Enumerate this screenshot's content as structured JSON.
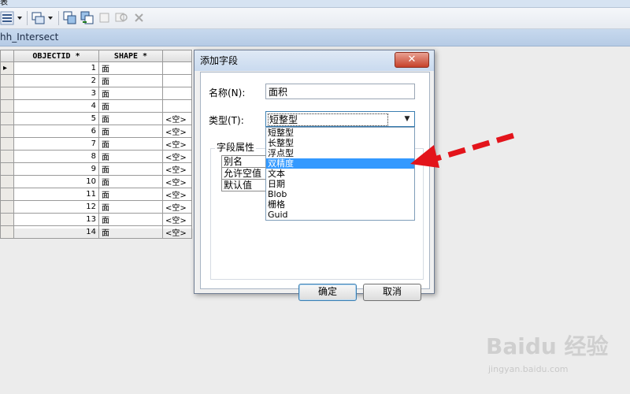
{
  "window": {
    "title_fragment": "表"
  },
  "table_caption": "hh_Intersect",
  "grid": {
    "columns": [
      "OBJECTID *",
      "SHAPE *"
    ],
    "rows": [
      {
        "id": "1",
        "shape": "面",
        "extra": ""
      },
      {
        "id": "2",
        "shape": "面",
        "extra": ""
      },
      {
        "id": "3",
        "shape": "面",
        "extra": ""
      },
      {
        "id": "4",
        "shape": "面",
        "extra": ""
      },
      {
        "id": "5",
        "shape": "面",
        "extra": "<空>"
      },
      {
        "id": "6",
        "shape": "面",
        "extra": "<空>"
      },
      {
        "id": "7",
        "shape": "面",
        "extra": "<空>"
      },
      {
        "id": "8",
        "shape": "面",
        "extra": "<空>"
      },
      {
        "id": "9",
        "shape": "面",
        "extra": "<空>"
      },
      {
        "id": "10",
        "shape": "面",
        "extra": "<空>"
      },
      {
        "id": "11",
        "shape": "面",
        "extra": "<空>"
      },
      {
        "id": "12",
        "shape": "面",
        "extra": "<空>"
      },
      {
        "id": "13",
        "shape": "面",
        "extra": "<空>"
      },
      {
        "id": "14",
        "shape": "面",
        "extra": "<空>"
      }
    ]
  },
  "dialog": {
    "title": "添加字段",
    "close_label": "✕",
    "name_label": "名称(N):",
    "name_value": "面积",
    "type_label": "类型(T):",
    "type_value": "短整型",
    "field_props_label": "字段属性",
    "prop_rows": [
      "别名",
      "允许空值",
      "默认值"
    ],
    "type_options": [
      "短整型",
      "长整型",
      "浮点型",
      "双精度",
      "文本",
      "日期",
      "Blob",
      "栅格",
      "Guid"
    ],
    "highlighted_option": "双精度",
    "ok_label": "确定",
    "cancel_label": "取消"
  },
  "annotation": {
    "arrow_color": "#e3141b"
  },
  "watermark": {
    "brand": "Baidu 经验",
    "url": "jingyan.baidu.com"
  }
}
